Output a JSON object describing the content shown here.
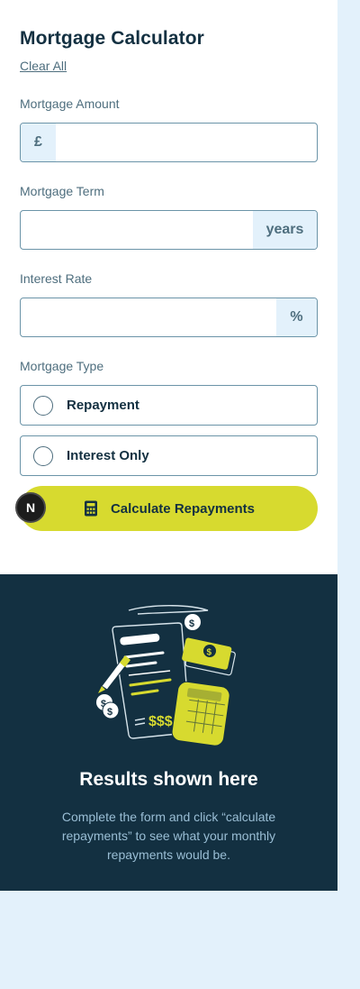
{
  "form": {
    "title": "Mortgage Calculator",
    "clear_label": "Clear All",
    "amount": {
      "label": "Mortgage Amount",
      "prefix": "£",
      "value": ""
    },
    "term": {
      "label": "Mortgage Term",
      "suffix": "years",
      "value": ""
    },
    "rate": {
      "label": "Interest Rate",
      "suffix": "%",
      "value": ""
    },
    "type": {
      "label": "Mortgage Type",
      "options": [
        "Repayment",
        "Interest Only"
      ]
    },
    "submit_label": "Calculate Repayments",
    "submit_icon": "calculator-icon"
  },
  "badge": {
    "letter": "N"
  },
  "results": {
    "title": "Results shown here",
    "text": "Complete the form and click “calculate repayments” to see what your monthly repayments would be."
  },
  "colors": {
    "accent": "#d7da2f",
    "dark": "#133041",
    "slate": "#4e6e7e",
    "light_bg": "#e3f1fb"
  }
}
